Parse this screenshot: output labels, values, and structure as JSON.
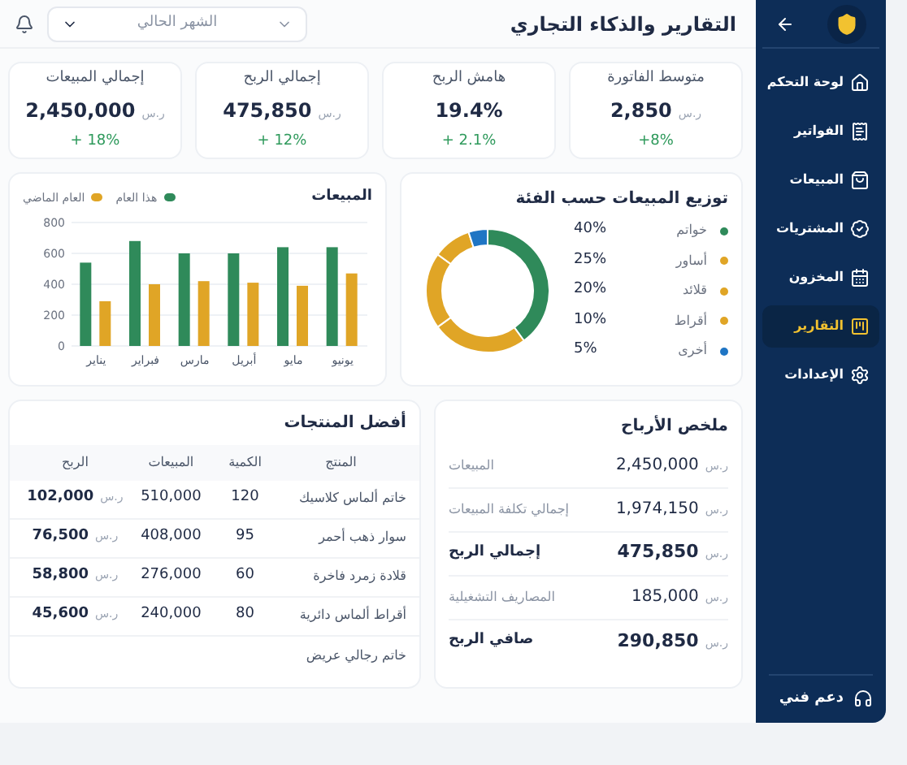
{
  "sidebar": {
    "items": [
      {
        "label": "لوحة التحكم",
        "selected": false
      },
      {
        "label": "الفواتير",
        "selected": false
      },
      {
        "label": "المبيعات",
        "selected": false
      },
      {
        "label": "المشتريات",
        "selected": false
      },
      {
        "label": "المخزون",
        "selected": false
      },
      {
        "label": "التقارير",
        "selected": true
      },
      {
        "label": "الإعدادات",
        "selected": false
      }
    ],
    "support": "دعم فني"
  },
  "header": {
    "title": "التقارير والذكاء التجاري",
    "period": "الشهر الحالي"
  },
  "kpis": [
    {
      "label": "متوسط الفاتورة",
      "value": "2,850",
      "currency": "ر.س",
      "change": "+8%"
    },
    {
      "label": "هامش الربح",
      "value": "19.4%",
      "change": "+ 2.1%"
    },
    {
      "label": "إجمالي الربح",
      "value": "475,850",
      "currency": "ر.س",
      "change": "+ 12%"
    },
    {
      "label": "إجمالي المبيعات",
      "value": "2,450,000",
      "currency": "ر.س",
      "change": "+ 18%"
    }
  ],
  "category_chart": {
    "title": "توزيع المبيعات حسب الفئة",
    "chart_data": {
      "type": "donut",
      "categories": [
        "خواتم",
        "أساور",
        "قلائد",
        "أقراط",
        "أخرى"
      ],
      "values": [
        40,
        25,
        20,
        10,
        5
      ],
      "colors": [
        "#2f8a5a",
        "#e0a526",
        "#e0a526",
        "#e0a526",
        "#1f75c4"
      ],
      "value_labels": [
        "40%",
        "25%",
        "20%",
        "10%",
        "5%"
      ]
    }
  },
  "sales_chart": {
    "chart_data": {
      "type": "bar",
      "title": "المبيعات",
      "categories": [
        "يناير",
        "فبراير",
        "مارس",
        "أبريل",
        "مايو",
        "يونيو"
      ],
      "ylim": [
        0,
        800
      ],
      "grid": true,
      "yticks": [
        0,
        200,
        400,
        600,
        800
      ],
      "series": [
        {
          "name": "هذا العام",
          "color": "#2f8a5a",
          "values": [
            540,
            680,
            600,
            600,
            640,
            640
          ]
        },
        {
          "name": "العام الماضي",
          "color": "#e0a526",
          "values": [
            290,
            400,
            420,
            410,
            390,
            470
          ]
        }
      ]
    }
  },
  "profit_summary": {
    "title": "ملخص الأرباح",
    "rows": [
      {
        "label": "المبيعات",
        "value": "2,450,000",
        "currency": "ر.س",
        "emphasis": false
      },
      {
        "label": "إجمالي تكلفة المبيعات",
        "value": "1,974,150",
        "currency": "ر.س",
        "emphasis": false
      },
      {
        "label": "إجمالي الربح",
        "value": "475,850",
        "currency": "ر.س",
        "emphasis": true
      },
      {
        "label": "المصاريف التشغيلية",
        "value": "185,000",
        "currency": "ر.س",
        "emphasis": false
      },
      {
        "label": "صافي الربح",
        "value": "290,850",
        "currency": "ر.س",
        "emphasis": true
      }
    ]
  },
  "top_products": {
    "title": "أفضل المنتجات",
    "columns": [
      "المنتج",
      "الكمية",
      "المبيعات",
      "الربح"
    ],
    "rows": [
      {
        "product": "خاتم ألماس كلاسيك",
        "quantity": "120",
        "sales": "510,000",
        "profit": "102,000",
        "currency": "ر.س"
      },
      {
        "product": "سوار ذهب أحمر",
        "quantity": "95",
        "sales": "408,000",
        "profit": "76,500",
        "currency": "ر.س"
      },
      {
        "product": "قلادة زمرد فاخرة",
        "quantity": "60",
        "sales": "276,000",
        "profit": "58,800",
        "currency": "ر.س"
      },
      {
        "product": "أقراط ألماس دائرية",
        "quantity": "80",
        "sales": "240,000",
        "profit": "45,600",
        "currency": "ر.س"
      },
      {
        "product": "خاتم رجالي عريض"
      }
    ]
  }
}
